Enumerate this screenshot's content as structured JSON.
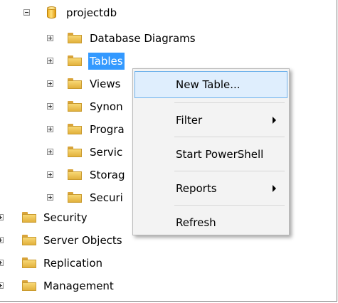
{
  "tree": {
    "database": "projectdb",
    "children": [
      "Database Diagrams",
      "Tables",
      "Views",
      "Synon",
      "Progra",
      "Servic",
      "Storag",
      "Securi"
    ],
    "roots": [
      "Security",
      "Server Objects",
      "Replication",
      "Management"
    ]
  },
  "context_menu": {
    "items": [
      "New Table...",
      "Filter",
      "Start PowerShell",
      "Reports",
      "Refresh"
    ]
  },
  "colors": {
    "selection": "#3399ff",
    "menu_highlight": "#dfeefd",
    "folder": "#f0c75a"
  }
}
